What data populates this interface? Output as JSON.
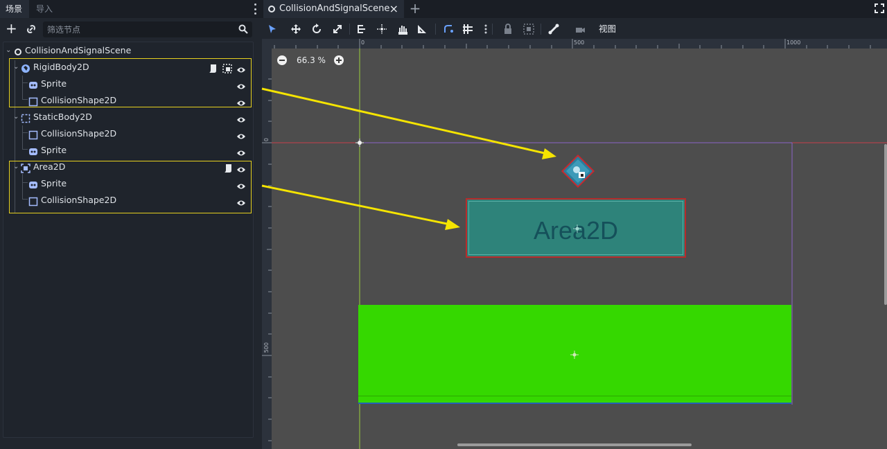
{
  "dock": {
    "tabs": [
      "场景",
      "导入"
    ],
    "filter_placeholder": "筛选节点"
  },
  "tree": {
    "nodes": [
      {
        "label": "CollisionAndSignalScene"
      },
      {
        "label": "RigidBody2D"
      },
      {
        "label": "Sprite"
      },
      {
        "label": "CollisionShape2D"
      },
      {
        "label": "StaticBody2D"
      },
      {
        "label": "CollisionShape2D"
      },
      {
        "label": "Sprite"
      },
      {
        "label": "Area2D"
      },
      {
        "label": "Sprite"
      },
      {
        "label": "CollisionShape2D"
      }
    ]
  },
  "editor": {
    "scene_tab": "CollisionAndSignalScene",
    "close_glyph": "×",
    "new_tab_glyph": "+",
    "view_menu": "视图",
    "zoom": "66.3 %",
    "ruler": {
      "top": [
        "0",
        "500",
        "1000"
      ],
      "left": [
        "0",
        "500"
      ]
    },
    "area_text": "Area2D"
  },
  "colors": {
    "highlight": "#e8d21f",
    "area_fill": "#2e837a",
    "static_fill": "#35d800",
    "collision_outline": "#b92a2a",
    "arrow": "#f5e400"
  },
  "icons": [
    "add-node-icon",
    "link-icon",
    "search-icon",
    "eye-icon",
    "script-icon",
    "group-icon",
    "scene-root-icon",
    "rigidbody-icon",
    "sprite-icon",
    "collisionshape-icon",
    "staticbody-icon",
    "area2d-icon"
  ]
}
